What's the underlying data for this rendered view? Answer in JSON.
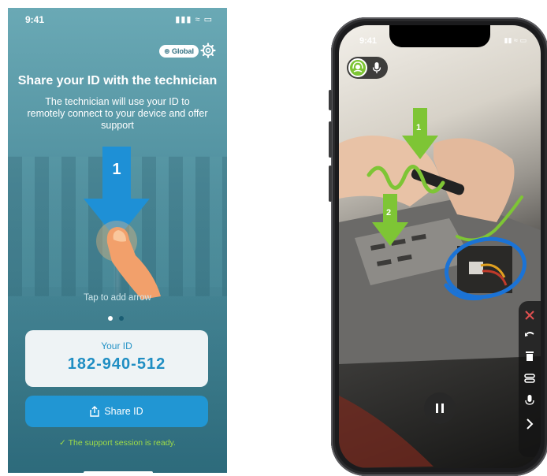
{
  "left": {
    "status_time": "9:41",
    "status_icons": "▮▮▮ ≈ ▭",
    "global_label": "⊕ Global",
    "title": "Share your ID with the technician",
    "subtitle": "The technician will use your ID to remotely connect to your device and offer support",
    "arrow_number": "1",
    "tap_hint": "Tap to add arrow",
    "id_label": "Your ID",
    "id_value": "182-940-512",
    "share_label": "Share ID",
    "ready_text": "✓  The support session is ready."
  },
  "right": {
    "status_time": "9:41",
    "status_icons": "▮▮ ≈ ▭",
    "arrow1_number": "1",
    "arrow2_number": "2"
  },
  "colors": {
    "accent_blue": "#2196d3",
    "id_blue": "#1f8ec3",
    "annotation_green": "#7ec535",
    "annotation_blue": "#1b73d6",
    "ready_green": "#9fdc47"
  }
}
